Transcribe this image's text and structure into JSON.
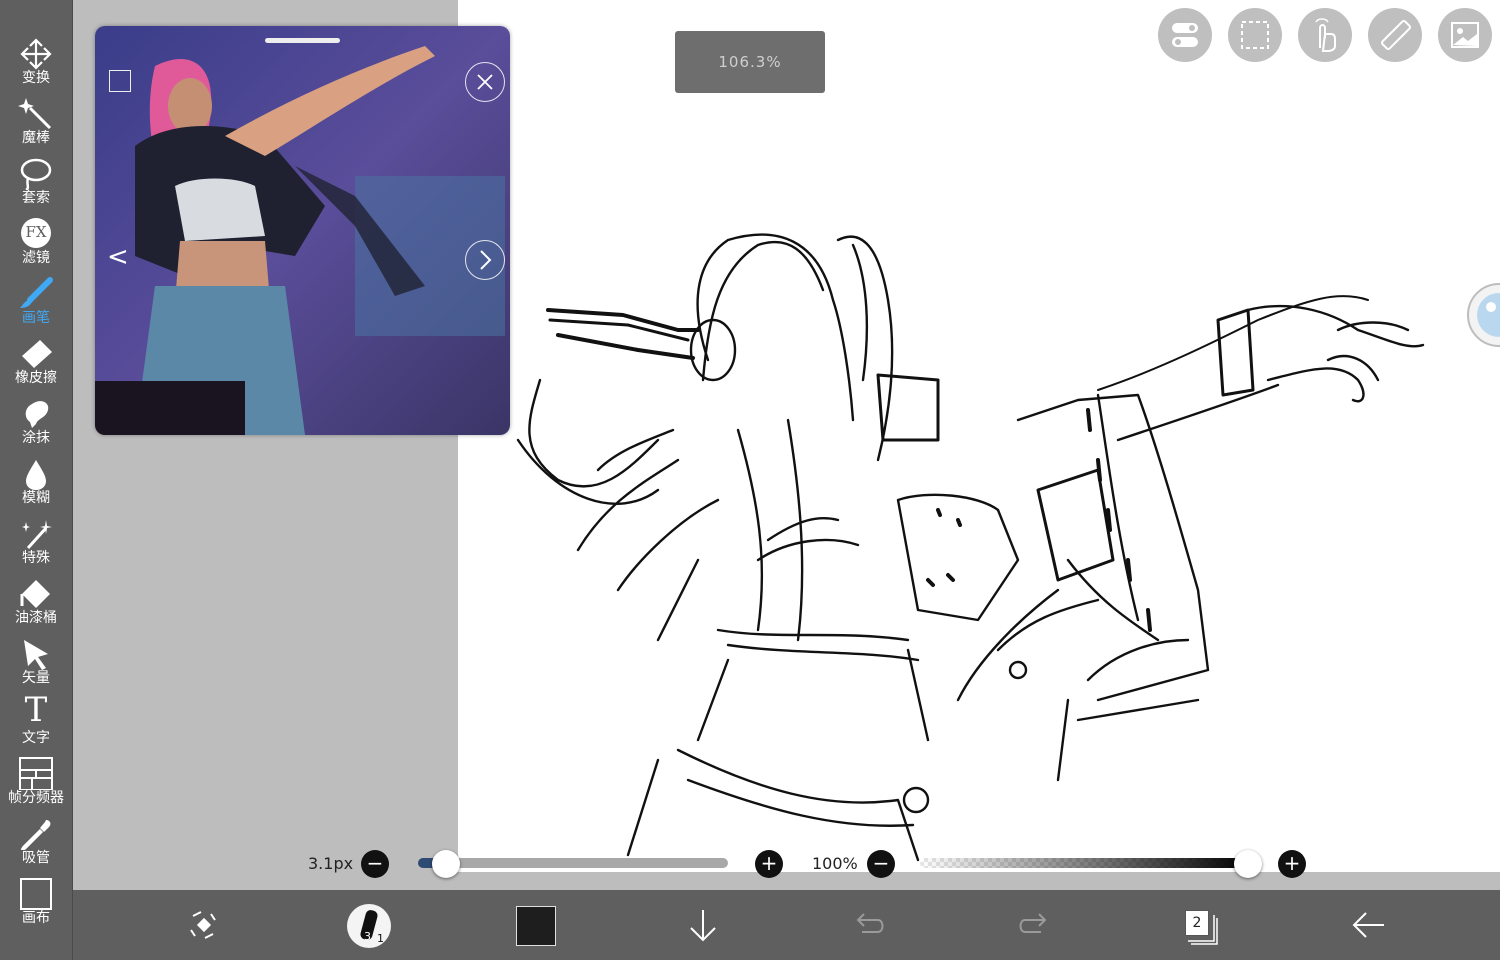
{
  "toolbar": {
    "items": [
      {
        "label": "变换",
        "icon": "move-arrows-icon"
      },
      {
        "label": "魔棒",
        "icon": "magic-wand-icon"
      },
      {
        "label": "套索",
        "icon": "lasso-icon"
      },
      {
        "label": "滤镜",
        "icon": "fx-filter-icon",
        "glyph": "FX"
      },
      {
        "label": "画笔",
        "icon": "brush-icon",
        "active": true
      },
      {
        "label": "橡皮擦",
        "icon": "eraser-icon"
      },
      {
        "label": "涂抹",
        "icon": "smudge-icon"
      },
      {
        "label": "模糊",
        "icon": "blur-drop-icon"
      },
      {
        "label": "特殊",
        "icon": "special-sparkle-icon"
      },
      {
        "label": "油漆桶",
        "icon": "paint-bucket-icon"
      },
      {
        "label": "矢量",
        "icon": "vector-cursor-icon"
      },
      {
        "label": "文字",
        "icon": "text-icon",
        "glyph": "T"
      },
      {
        "label": "帧分频器",
        "icon": "frame-divider-icon"
      },
      {
        "label": "吸管",
        "icon": "eyedropper-icon"
      },
      {
        "label": "画布",
        "icon": "canvas-icon"
      }
    ]
  },
  "zoom": {
    "value": "106.3%"
  },
  "reference": {
    "prev_glyph": "<",
    "next_glyph": ">",
    "close_icon": "close-icon"
  },
  "top_buttons": [
    "toggle-settings-icon",
    "selection-icon",
    "hand-touch-icon",
    "ruler-icon",
    "image-reference-icon"
  ],
  "brush": {
    "size": "3.1px",
    "size_fraction": 0.07,
    "opacity": "100%",
    "opacity_fraction": 1.0,
    "minus": "−",
    "plus": "+"
  },
  "bottom": {
    "brush_preview_top": "3",
    "brush_preview_bottom": "1",
    "layer_count": "2",
    "color": "#1e1e1e"
  },
  "colors": {
    "accent": "#3fa9f5",
    "toolbar_bg": "#5f5f5f",
    "workspace_bg": "#bdbdbd",
    "canvas_bg": "#ffffff"
  }
}
